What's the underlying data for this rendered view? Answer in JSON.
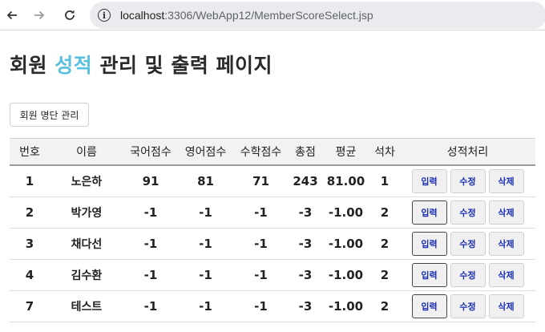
{
  "browser": {
    "url_host": "localhost",
    "url_path": ":3306/WebApp12/MemberScoreSelect.jsp"
  },
  "page": {
    "title_part1": "회원 ",
    "title_accent": "성적",
    "title_part2": " 관리 및 출력 페이지",
    "member_button": "회원 명단 관리"
  },
  "table": {
    "headers": [
      "번호",
      "이름",
      "국어점수",
      "영어점수",
      "수학점수",
      "총점",
      "평균",
      "석차",
      "성적처리"
    ],
    "actions": {
      "input": "입력",
      "edit": "수정",
      "delete": "삭제"
    },
    "rows": [
      {
        "no": "1",
        "name": "노은하",
        "kor": "91",
        "eng": "81",
        "mat": "71",
        "tot": "243",
        "avg": "81.00",
        "rank": "1"
      },
      {
        "no": "2",
        "name": "박가영",
        "kor": "-1",
        "eng": "-1",
        "mat": "-1",
        "tot": "-3",
        "avg": "-1.00",
        "rank": "2"
      },
      {
        "no": "3",
        "name": "채다선",
        "kor": "-1",
        "eng": "-1",
        "mat": "-1",
        "tot": "-3",
        "avg": "-1.00",
        "rank": "2"
      },
      {
        "no": "4",
        "name": "김수환",
        "kor": "-1",
        "eng": "-1",
        "mat": "-1",
        "tot": "-3",
        "avg": "-1.00",
        "rank": "2"
      },
      {
        "no": "7",
        "name": "테스트",
        "kor": "-1",
        "eng": "-1",
        "mat": "-1",
        "tot": "-3",
        "avg": "-1.00",
        "rank": "2"
      }
    ]
  }
}
